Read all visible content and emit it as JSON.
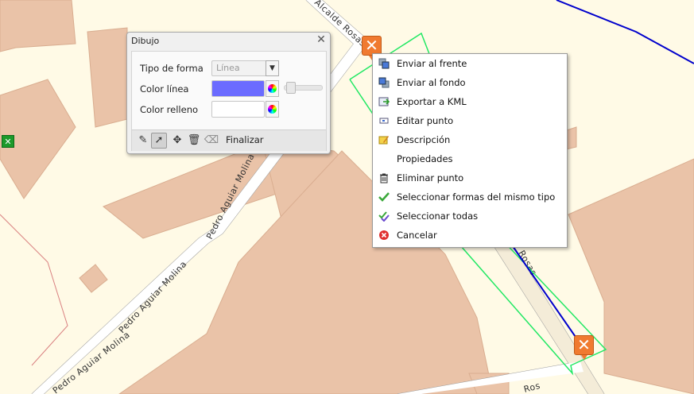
{
  "map": {
    "streets": {
      "left": "Pedro Aguiar Molina",
      "top": "Alcalde Rosas",
      "route": "Rosas",
      "bottom": "Ros"
    }
  },
  "panel": {
    "title": "Dibujo",
    "close_icon": "close-icon",
    "shape_type_label": "Tipo de forma",
    "shape_type_value": "Línea",
    "line_color_label": "Color línea",
    "line_color": "#6b6bff",
    "fill_color_label": "Color relleno",
    "fill_color": "#ffffff",
    "finalize_label": "Finalizar"
  },
  "menu": {
    "items": [
      {
        "label": "Enviar al frente",
        "icon": "bring-to-front-icon"
      },
      {
        "label": "Enviar al fondo",
        "icon": "send-to-back-icon"
      },
      {
        "label": "Exportar a KML",
        "icon": "export-kml-icon"
      },
      {
        "label": "Editar punto",
        "icon": "edit-point-icon"
      },
      {
        "label": "Descripción",
        "icon": "description-icon"
      },
      {
        "label": "Propiedades",
        "icon": ""
      },
      {
        "label": "Eliminar punto",
        "icon": "trash-icon"
      },
      {
        "label": "Seleccionar formas del mismo tipo",
        "icon": "check-icon"
      },
      {
        "label": "Seleccionar todas",
        "icon": "double-check-icon"
      },
      {
        "label": "Cancelar",
        "icon": "cancel-icon"
      }
    ]
  },
  "colors": {
    "map_background": "#fffae6",
    "building": "#eac3a8",
    "selection_outline": "#22e864",
    "route_line": "#0000cc",
    "marker": "#f07a30"
  }
}
